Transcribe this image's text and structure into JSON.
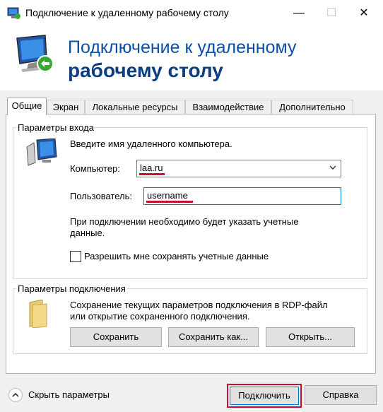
{
  "window": {
    "title": "Подключение к удаленному рабочему столу",
    "minimize_glyph": "—",
    "maximize_glyph": "☐",
    "close_glyph": "✕"
  },
  "banner": {
    "line1": "Подключение к удаленному",
    "line2": "рабочему столу"
  },
  "tabs": [
    {
      "label": "Общие",
      "active": true
    },
    {
      "label": "Экран"
    },
    {
      "label": "Локальные ресурсы"
    },
    {
      "label": "Взаимодействие"
    },
    {
      "label": "Дополнительно"
    }
  ],
  "login": {
    "group_title": "Параметры входа",
    "prompt": "Введите имя удаленного компьютера.",
    "computer_label": "Компьютер:",
    "computer_value": "laa.ru",
    "user_label": "Пользователь:",
    "user_value": "username",
    "note": "При подключении необходимо будет указать учетные данные.",
    "note_line1": "При подключении необходимо будет указать учетные",
    "note_line2": "данные.",
    "save_creds_label": "Разрешить мне сохранять учетные данные",
    "save_creds_checked": false
  },
  "connection": {
    "group_title": "Параметры подключения",
    "desc_line1": "Сохранение текущих параметров подключения в RDP-файл",
    "desc_line2": "или открытие сохраненного подключения.",
    "save_button": "Сохранить",
    "save_as_button": "Сохранить как...",
    "open_button": "Открыть..."
  },
  "footer": {
    "hide_options": "Скрыть параметры",
    "connect_button": "Подключить",
    "help_button": "Справка"
  },
  "icons": {
    "app": "remote-desktop-icon",
    "banner": "remote-desktop-large-icon",
    "login": "computer-icon",
    "connection": "folder-icon",
    "hide": "chevron-up-icon"
  },
  "colors": {
    "heading": "#0b4fa8",
    "heading_bold": "#0b3d80",
    "highlight": "#c8102e",
    "focus": "#0078d7"
  }
}
